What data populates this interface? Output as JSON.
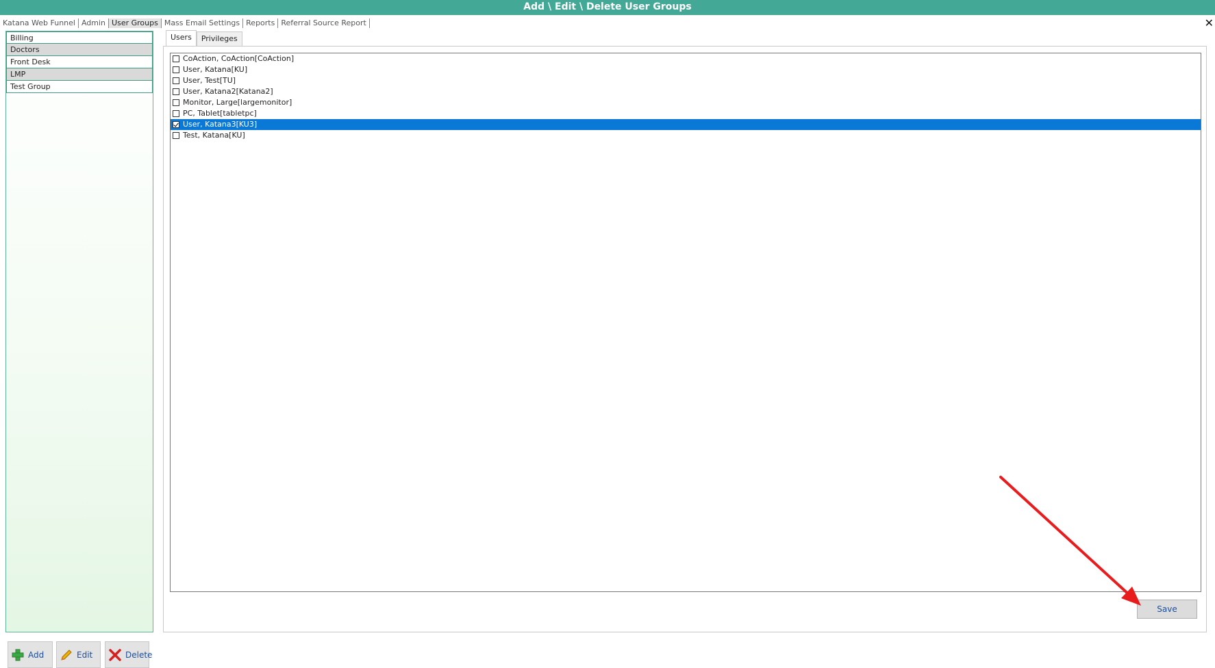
{
  "window": {
    "title": "Add \\ Edit \\ Delete User Groups",
    "close_glyph": "✕"
  },
  "menu": [
    {
      "label": "Katana Web Funnel",
      "active": false
    },
    {
      "label": "Admin",
      "active": false
    },
    {
      "label": "User Groups",
      "active": true
    },
    {
      "label": "Mass Email Settings",
      "active": false
    },
    {
      "label": "Reports",
      "active": false
    },
    {
      "label": "Referral Source Report",
      "active": false
    }
  ],
  "groups": [
    {
      "label": "Billing"
    },
    {
      "label": "Doctors"
    },
    {
      "label": "Front Desk"
    },
    {
      "label": "LMP"
    },
    {
      "label": "Test Group"
    }
  ],
  "tabs": [
    {
      "label": "Users",
      "active": true
    },
    {
      "label": "Privileges",
      "active": false
    }
  ],
  "users": [
    {
      "label": "CoAction, CoAction[CoAction]",
      "checked": false,
      "selected": false
    },
    {
      "label": "User, Katana[KU]",
      "checked": false,
      "selected": false
    },
    {
      "label": "User, Test[TU]",
      "checked": false,
      "selected": false
    },
    {
      "label": "User, Katana2[Katana2]",
      "checked": false,
      "selected": false
    },
    {
      "label": "Monitor, Large[largemonitor]",
      "checked": false,
      "selected": false
    },
    {
      "label": "PC, Tablet[tabletpc]",
      "checked": false,
      "selected": false
    },
    {
      "label": "User, Katana3[KU3]",
      "checked": true,
      "selected": true
    },
    {
      "label": "Test, Katana[KU]",
      "checked": false,
      "selected": false
    }
  ],
  "save_label": "Save",
  "bottom_buttons": {
    "add_label": "Add",
    "edit_label": "Edit",
    "delete_label": "Delete"
  },
  "colors": {
    "title_bar": "#43a896",
    "selection": "#0a78d7",
    "annotation_arrow": "#e81c1c"
  }
}
